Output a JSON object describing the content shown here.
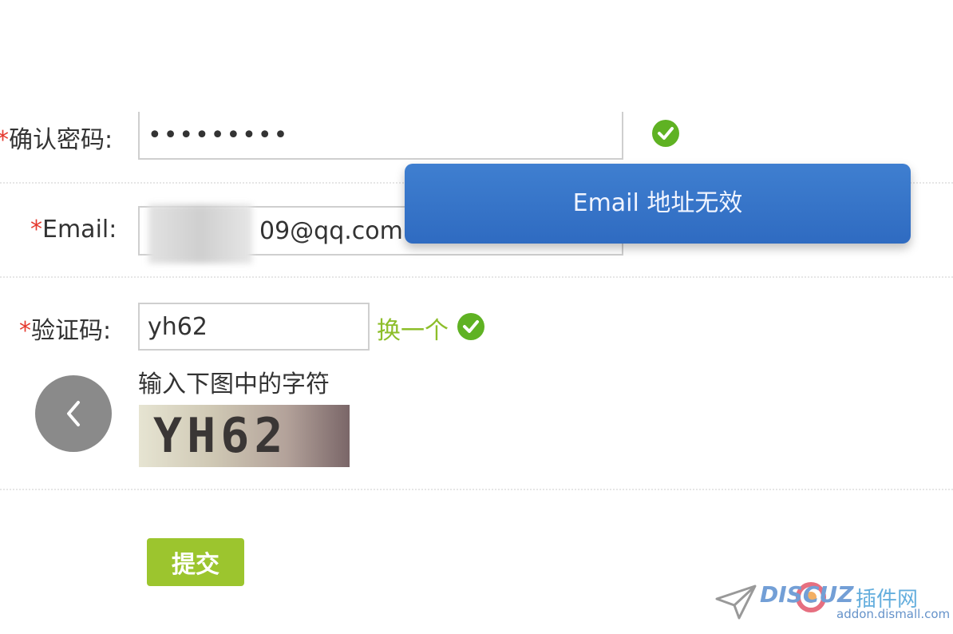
{
  "form": {
    "confirm_password": {
      "required_mark": "*",
      "label": "确认密码:",
      "value": "•••••••••",
      "valid": true
    },
    "email": {
      "required_mark": "*",
      "label": "*Email:",
      "value": "09@qq.com",
      "valid": true
    },
    "captcha": {
      "required_mark": "*",
      "label": "验证码:",
      "value": "yh62",
      "swap_link": "换一个",
      "valid": true,
      "hint": "输入下图中的字符",
      "image_text": "YH62"
    },
    "submit_label": "提交"
  },
  "toast": {
    "message": "Email 地址无效"
  },
  "watermark": {
    "logo": "DISCUZ",
    "logo_cn": "插件网",
    "url": "addon.dismall.com"
  },
  "colors": {
    "accent_green": "#9cc52e",
    "check_green": "#5fb223",
    "toast_blue": "#3f7fd0",
    "required_red": "#e53a2f"
  },
  "icons": {
    "back": "chevron-left-icon",
    "valid": "check-circle-icon"
  }
}
